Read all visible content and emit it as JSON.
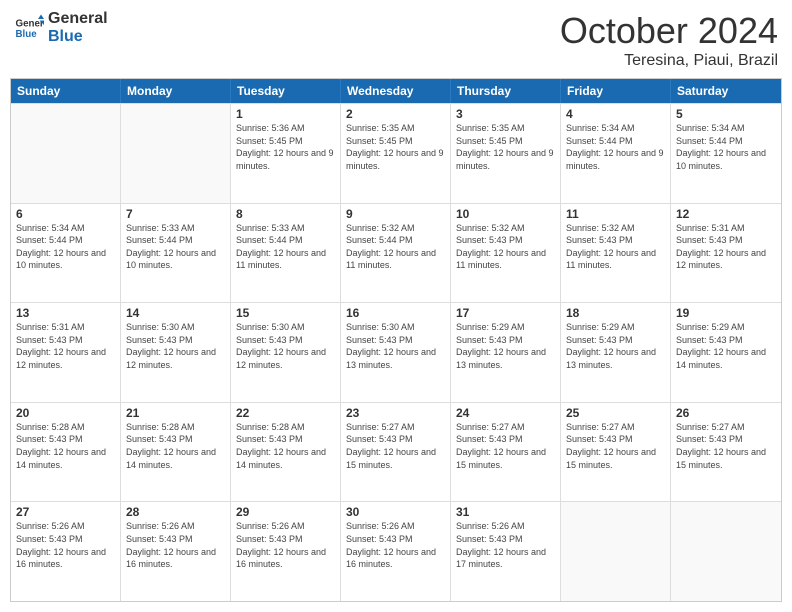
{
  "header": {
    "logo_line1": "General",
    "logo_line2": "Blue",
    "month_title": "October 2024",
    "subtitle": "Teresina, Piaui, Brazil"
  },
  "weekdays": [
    "Sunday",
    "Monday",
    "Tuesday",
    "Wednesday",
    "Thursday",
    "Friday",
    "Saturday"
  ],
  "rows": [
    [
      {
        "day": "",
        "info": ""
      },
      {
        "day": "",
        "info": ""
      },
      {
        "day": "1",
        "info": "Sunrise: 5:36 AM\nSunset: 5:45 PM\nDaylight: 12 hours and 9 minutes."
      },
      {
        "day": "2",
        "info": "Sunrise: 5:35 AM\nSunset: 5:45 PM\nDaylight: 12 hours and 9 minutes."
      },
      {
        "day": "3",
        "info": "Sunrise: 5:35 AM\nSunset: 5:45 PM\nDaylight: 12 hours and 9 minutes."
      },
      {
        "day": "4",
        "info": "Sunrise: 5:34 AM\nSunset: 5:44 PM\nDaylight: 12 hours and 9 minutes."
      },
      {
        "day": "5",
        "info": "Sunrise: 5:34 AM\nSunset: 5:44 PM\nDaylight: 12 hours and 10 minutes."
      }
    ],
    [
      {
        "day": "6",
        "info": "Sunrise: 5:34 AM\nSunset: 5:44 PM\nDaylight: 12 hours and 10 minutes."
      },
      {
        "day": "7",
        "info": "Sunrise: 5:33 AM\nSunset: 5:44 PM\nDaylight: 12 hours and 10 minutes."
      },
      {
        "day": "8",
        "info": "Sunrise: 5:33 AM\nSunset: 5:44 PM\nDaylight: 12 hours and 11 minutes."
      },
      {
        "day": "9",
        "info": "Sunrise: 5:32 AM\nSunset: 5:44 PM\nDaylight: 12 hours and 11 minutes."
      },
      {
        "day": "10",
        "info": "Sunrise: 5:32 AM\nSunset: 5:43 PM\nDaylight: 12 hours and 11 minutes."
      },
      {
        "day": "11",
        "info": "Sunrise: 5:32 AM\nSunset: 5:43 PM\nDaylight: 12 hours and 11 minutes."
      },
      {
        "day": "12",
        "info": "Sunrise: 5:31 AM\nSunset: 5:43 PM\nDaylight: 12 hours and 12 minutes."
      }
    ],
    [
      {
        "day": "13",
        "info": "Sunrise: 5:31 AM\nSunset: 5:43 PM\nDaylight: 12 hours and 12 minutes."
      },
      {
        "day": "14",
        "info": "Sunrise: 5:30 AM\nSunset: 5:43 PM\nDaylight: 12 hours and 12 minutes."
      },
      {
        "day": "15",
        "info": "Sunrise: 5:30 AM\nSunset: 5:43 PM\nDaylight: 12 hours and 12 minutes."
      },
      {
        "day": "16",
        "info": "Sunrise: 5:30 AM\nSunset: 5:43 PM\nDaylight: 12 hours and 13 minutes."
      },
      {
        "day": "17",
        "info": "Sunrise: 5:29 AM\nSunset: 5:43 PM\nDaylight: 12 hours and 13 minutes."
      },
      {
        "day": "18",
        "info": "Sunrise: 5:29 AM\nSunset: 5:43 PM\nDaylight: 12 hours and 13 minutes."
      },
      {
        "day": "19",
        "info": "Sunrise: 5:29 AM\nSunset: 5:43 PM\nDaylight: 12 hours and 14 minutes."
      }
    ],
    [
      {
        "day": "20",
        "info": "Sunrise: 5:28 AM\nSunset: 5:43 PM\nDaylight: 12 hours and 14 minutes."
      },
      {
        "day": "21",
        "info": "Sunrise: 5:28 AM\nSunset: 5:43 PM\nDaylight: 12 hours and 14 minutes."
      },
      {
        "day": "22",
        "info": "Sunrise: 5:28 AM\nSunset: 5:43 PM\nDaylight: 12 hours and 14 minutes."
      },
      {
        "day": "23",
        "info": "Sunrise: 5:27 AM\nSunset: 5:43 PM\nDaylight: 12 hours and 15 minutes."
      },
      {
        "day": "24",
        "info": "Sunrise: 5:27 AM\nSunset: 5:43 PM\nDaylight: 12 hours and 15 minutes."
      },
      {
        "day": "25",
        "info": "Sunrise: 5:27 AM\nSunset: 5:43 PM\nDaylight: 12 hours and 15 minutes."
      },
      {
        "day": "26",
        "info": "Sunrise: 5:27 AM\nSunset: 5:43 PM\nDaylight: 12 hours and 15 minutes."
      }
    ],
    [
      {
        "day": "27",
        "info": "Sunrise: 5:26 AM\nSunset: 5:43 PM\nDaylight: 12 hours and 16 minutes."
      },
      {
        "day": "28",
        "info": "Sunrise: 5:26 AM\nSunset: 5:43 PM\nDaylight: 12 hours and 16 minutes."
      },
      {
        "day": "29",
        "info": "Sunrise: 5:26 AM\nSunset: 5:43 PM\nDaylight: 12 hours and 16 minutes."
      },
      {
        "day": "30",
        "info": "Sunrise: 5:26 AM\nSunset: 5:43 PM\nDaylight: 12 hours and 16 minutes."
      },
      {
        "day": "31",
        "info": "Sunrise: 5:26 AM\nSunset: 5:43 PM\nDaylight: 12 hours and 17 minutes."
      },
      {
        "day": "",
        "info": ""
      },
      {
        "day": "",
        "info": ""
      }
    ]
  ]
}
